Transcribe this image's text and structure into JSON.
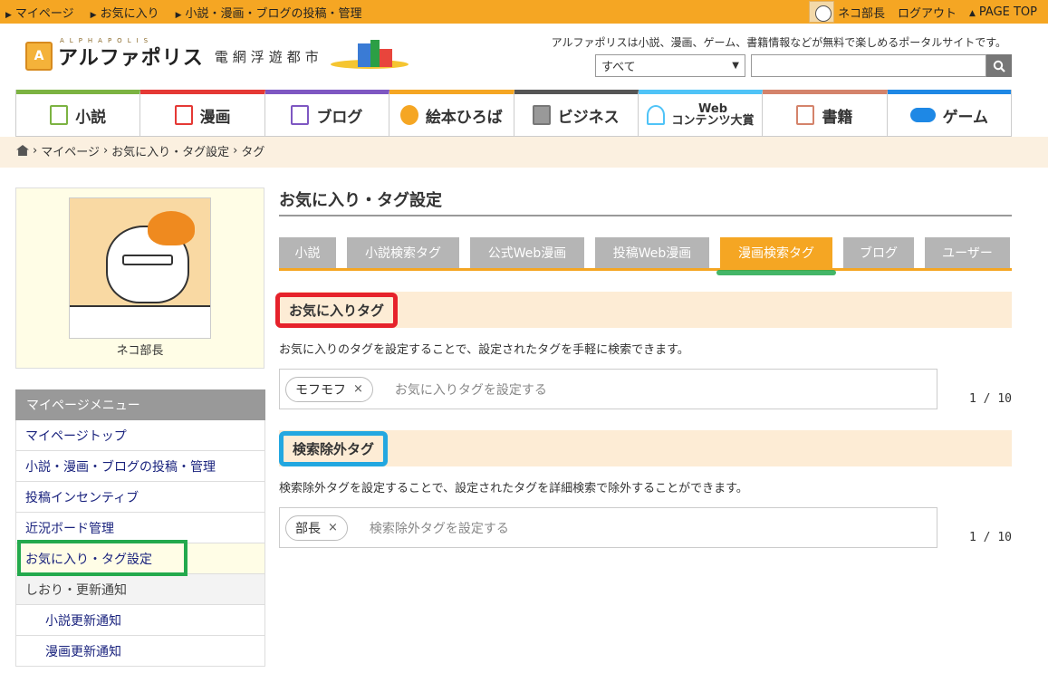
{
  "topbar": {
    "links": [
      "マイページ",
      "お気に入り",
      "小説・漫画・ブログの投稿・管理"
    ],
    "user_name": "ネコ部長",
    "logout": "ログアウト",
    "page_top": "PAGE TOP"
  },
  "header": {
    "logo_top": "ALPHAPOLIS",
    "logo_name": "アルファポリス",
    "logo_sub": "電網浮遊都市",
    "tagline": "アルファポリスは小説、漫画、ゲーム、書籍情報などが無料で楽しめるポータルサイトです。",
    "search_select": "すべて",
    "search_value": ""
  },
  "categories": [
    {
      "label": "小説",
      "color": "#7cb342"
    },
    {
      "label": "漫画",
      "color": "#e53935"
    },
    {
      "label": "ブログ",
      "color": "#7e57c2"
    },
    {
      "label": "絵本ひろば",
      "color": "#f5a623"
    },
    {
      "label": "ビジネス",
      "color": "#555555"
    },
    {
      "label_top": "Web",
      "label": "コンテンツ大賞",
      "color": "#4fc3f7"
    },
    {
      "label": "書籍",
      "color": "#d4836b"
    },
    {
      "label": "ゲーム",
      "color": "#1e88e5"
    }
  ],
  "breadcrumb": [
    "マイページ",
    "お気に入り・タグ設定",
    "タグ"
  ],
  "profile": {
    "name": "ネコ部長"
  },
  "menu": {
    "title": "マイページメニュー",
    "items": [
      "マイページトップ",
      "小説・漫画・ブログの投稿・管理",
      "投稿インセンティブ",
      "近況ボード管理",
      "お気に入り・タグ設定",
      "しおり・更新通知",
      "小説更新通知",
      "漫画更新通知"
    ]
  },
  "main": {
    "title": "お気に入り・タグ設定",
    "tabs": [
      "小説",
      "小説検索タグ",
      "公式Web漫画",
      "投稿Web漫画",
      "漫画検索タグ",
      "ブログ",
      "ユーザー"
    ],
    "active_tab": "漫画検索タグ",
    "favorite": {
      "heading": "お気に入りタグ",
      "desc": "お気に入りのタグを設定することで、設定されたタグを手軽に検索できます。",
      "chip": "モフモフ",
      "placeholder": "お気に入りタグを設定する",
      "count": "1 / 10"
    },
    "exclude": {
      "heading": "検索除外タグ",
      "desc": "検索除外タグを設定することで、設定されたタグを詳細検索で除外することができます。",
      "chip": "部長",
      "placeholder": "検索除外タグを設定する",
      "count": "1 / 10"
    }
  },
  "colors": {
    "accent": "#f5a623",
    "annotation_red": "#e6222b",
    "annotation_blue": "#22a7e0",
    "annotation_green": "#23a94d"
  }
}
